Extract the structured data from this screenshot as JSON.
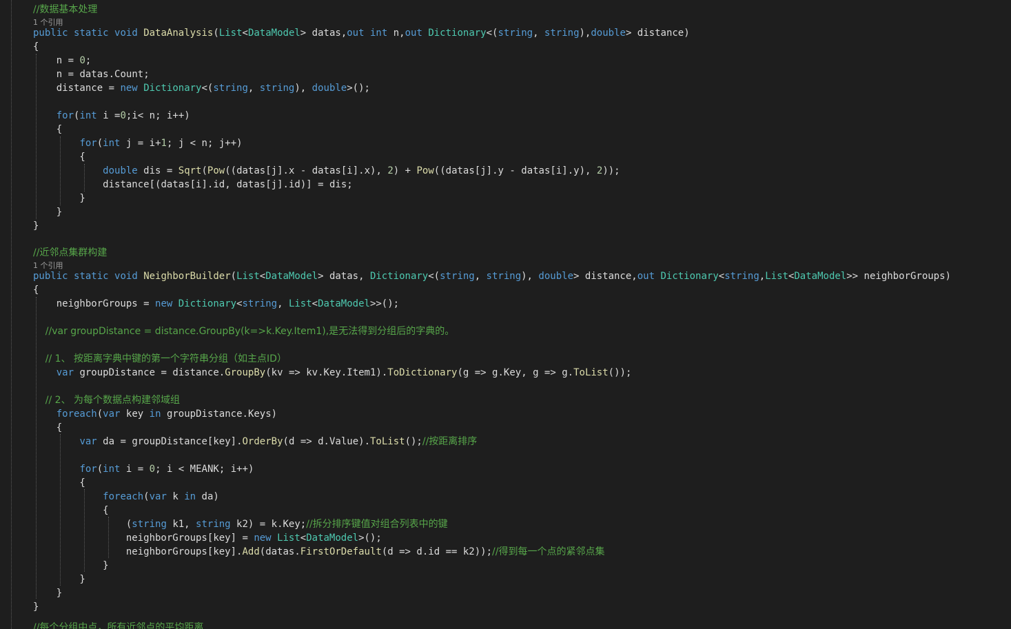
{
  "editor": {
    "codelens": "1 个引用",
    "lines": [
      {
        "t": "//数据基本处理",
        "c": "cm"
      },
      {
        "t": "public static void DataAnalysis(List<DataModel> datas,out int n,out Dictionary<(string, string),double> distance)"
      },
      {
        "t": "{"
      },
      {
        "t": "    n = 0;"
      },
      {
        "t": "    n = datas.Count;"
      },
      {
        "t": "    distance = new Dictionary<(string, string), double>();"
      },
      {
        "t": ""
      },
      {
        "t": "    for(int i =0;i< n; i++)"
      },
      {
        "t": "    {"
      },
      {
        "t": "        for(int j = i+1; j < n; j++)"
      },
      {
        "t": "        {"
      },
      {
        "t": "            double dis = Sqrt(Pow((datas[j].x - datas[i].x), 2) + Pow((datas[j].y - datas[i].y), 2));"
      },
      {
        "t": "            distance[(datas[i].id, datas[j].id)] = dis;"
      },
      {
        "t": "        }"
      },
      {
        "t": "    }"
      },
      {
        "t": "}"
      },
      {
        "t": ""
      },
      {
        "t": "//近邻点集群构建",
        "c": "cm"
      },
      {
        "t": "public static void NeighborBuilder(List<DataModel> datas, Dictionary<(string, string), double> distance,out Dictionary<string,List<DataModel>> neighborGroups)"
      },
      {
        "t": "{"
      },
      {
        "t": "    neighborGroups = new Dictionary<string, List<DataModel>>();"
      },
      {
        "t": ""
      },
      {
        "t": "    //var groupDistance = distance.GroupBy(k=>k.Key.Item1),是无法得到分组后的字典的。",
        "c": "cm"
      },
      {
        "t": ""
      },
      {
        "t": "    // 1、 按距离字典中键的第一个字符串分组（如主点ID）",
        "c": "cm"
      },
      {
        "t": "    var groupDistance = distance.GroupBy(kv => kv.Key.Item1).ToDictionary(g => g.Key, g => g.ToList());"
      },
      {
        "t": ""
      },
      {
        "t": "    // 2、 为每个数据点构建邻域组",
        "c": "cm"
      },
      {
        "t": "    foreach(var key in groupDistance.Keys)"
      },
      {
        "t": "    {"
      },
      {
        "t": "        var da = groupDistance[key].OrderBy(d => d.Value).ToList();//按距离排序"
      },
      {
        "t": ""
      },
      {
        "t": "        for(int i = 0; i < MEANK; i++)"
      },
      {
        "t": "        {"
      },
      {
        "t": "            foreach(var k in da)"
      },
      {
        "t": "            {"
      },
      {
        "t": "                (string k1, string k2) = k.Key;//拆分排序键值对组合列表中的键"
      },
      {
        "t": "                neighborGroups[key] = new List<DataModel>();"
      },
      {
        "t": "                neighborGroups[key].Add(datas.FirstOrDefault(d => d.id == k2));//得到每一个点的紧邻点集"
      },
      {
        "t": "            }"
      },
      {
        "t": "        }"
      },
      {
        "t": "    }"
      },
      {
        "t": "}"
      },
      {
        "t": ""
      },
      {
        "t": "//每个分组中点，所有近邻点的平均距离",
        "c": "cm"
      }
    ]
  },
  "colors": {
    "background": "#1e1e1e",
    "keyword": "#569cd6",
    "type": "#4ec9b0",
    "comment": "#57a64a",
    "identifier": "#dcdcdc",
    "number": "#b5cea8"
  }
}
